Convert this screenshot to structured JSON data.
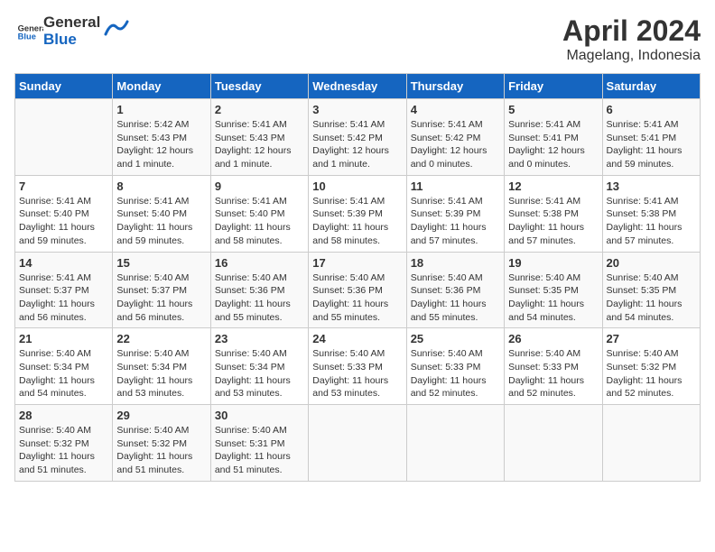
{
  "header": {
    "logo_general": "General",
    "logo_blue": "Blue",
    "title": "April 2024",
    "subtitle": "Magelang, Indonesia"
  },
  "days_of_week": [
    "Sunday",
    "Monday",
    "Tuesday",
    "Wednesday",
    "Thursday",
    "Friday",
    "Saturday"
  ],
  "weeks": [
    [
      {
        "day": "",
        "info": ""
      },
      {
        "day": "1",
        "info": "Sunrise: 5:42 AM\nSunset: 5:43 PM\nDaylight: 12 hours\nand 1 minute."
      },
      {
        "day": "2",
        "info": "Sunrise: 5:41 AM\nSunset: 5:43 PM\nDaylight: 12 hours\nand 1 minute."
      },
      {
        "day": "3",
        "info": "Sunrise: 5:41 AM\nSunset: 5:42 PM\nDaylight: 12 hours\nand 1 minute."
      },
      {
        "day": "4",
        "info": "Sunrise: 5:41 AM\nSunset: 5:42 PM\nDaylight: 12 hours\nand 0 minutes."
      },
      {
        "day": "5",
        "info": "Sunrise: 5:41 AM\nSunset: 5:41 PM\nDaylight: 12 hours\nand 0 minutes."
      },
      {
        "day": "6",
        "info": "Sunrise: 5:41 AM\nSunset: 5:41 PM\nDaylight: 11 hours\nand 59 minutes."
      }
    ],
    [
      {
        "day": "7",
        "info": "Sunrise: 5:41 AM\nSunset: 5:40 PM\nDaylight: 11 hours\nand 59 minutes."
      },
      {
        "day": "8",
        "info": "Sunrise: 5:41 AM\nSunset: 5:40 PM\nDaylight: 11 hours\nand 59 minutes."
      },
      {
        "day": "9",
        "info": "Sunrise: 5:41 AM\nSunset: 5:40 PM\nDaylight: 11 hours\nand 58 minutes."
      },
      {
        "day": "10",
        "info": "Sunrise: 5:41 AM\nSunset: 5:39 PM\nDaylight: 11 hours\nand 58 minutes."
      },
      {
        "day": "11",
        "info": "Sunrise: 5:41 AM\nSunset: 5:39 PM\nDaylight: 11 hours\nand 57 minutes."
      },
      {
        "day": "12",
        "info": "Sunrise: 5:41 AM\nSunset: 5:38 PM\nDaylight: 11 hours\nand 57 minutes."
      },
      {
        "day": "13",
        "info": "Sunrise: 5:41 AM\nSunset: 5:38 PM\nDaylight: 11 hours\nand 57 minutes."
      }
    ],
    [
      {
        "day": "14",
        "info": "Sunrise: 5:41 AM\nSunset: 5:37 PM\nDaylight: 11 hours\nand 56 minutes."
      },
      {
        "day": "15",
        "info": "Sunrise: 5:40 AM\nSunset: 5:37 PM\nDaylight: 11 hours\nand 56 minutes."
      },
      {
        "day": "16",
        "info": "Sunrise: 5:40 AM\nSunset: 5:36 PM\nDaylight: 11 hours\nand 55 minutes."
      },
      {
        "day": "17",
        "info": "Sunrise: 5:40 AM\nSunset: 5:36 PM\nDaylight: 11 hours\nand 55 minutes."
      },
      {
        "day": "18",
        "info": "Sunrise: 5:40 AM\nSunset: 5:36 PM\nDaylight: 11 hours\nand 55 minutes."
      },
      {
        "day": "19",
        "info": "Sunrise: 5:40 AM\nSunset: 5:35 PM\nDaylight: 11 hours\nand 54 minutes."
      },
      {
        "day": "20",
        "info": "Sunrise: 5:40 AM\nSunset: 5:35 PM\nDaylight: 11 hours\nand 54 minutes."
      }
    ],
    [
      {
        "day": "21",
        "info": "Sunrise: 5:40 AM\nSunset: 5:34 PM\nDaylight: 11 hours\nand 54 minutes."
      },
      {
        "day": "22",
        "info": "Sunrise: 5:40 AM\nSunset: 5:34 PM\nDaylight: 11 hours\nand 53 minutes."
      },
      {
        "day": "23",
        "info": "Sunrise: 5:40 AM\nSunset: 5:34 PM\nDaylight: 11 hours\nand 53 minutes."
      },
      {
        "day": "24",
        "info": "Sunrise: 5:40 AM\nSunset: 5:33 PM\nDaylight: 11 hours\nand 53 minutes."
      },
      {
        "day": "25",
        "info": "Sunrise: 5:40 AM\nSunset: 5:33 PM\nDaylight: 11 hours\nand 52 minutes."
      },
      {
        "day": "26",
        "info": "Sunrise: 5:40 AM\nSunset: 5:33 PM\nDaylight: 11 hours\nand 52 minutes."
      },
      {
        "day": "27",
        "info": "Sunrise: 5:40 AM\nSunset: 5:32 PM\nDaylight: 11 hours\nand 52 minutes."
      }
    ],
    [
      {
        "day": "28",
        "info": "Sunrise: 5:40 AM\nSunset: 5:32 PM\nDaylight: 11 hours\nand 51 minutes."
      },
      {
        "day": "29",
        "info": "Sunrise: 5:40 AM\nSunset: 5:32 PM\nDaylight: 11 hours\nand 51 minutes."
      },
      {
        "day": "30",
        "info": "Sunrise: 5:40 AM\nSunset: 5:31 PM\nDaylight: 11 hours\nand 51 minutes."
      },
      {
        "day": "",
        "info": ""
      },
      {
        "day": "",
        "info": ""
      },
      {
        "day": "",
        "info": ""
      },
      {
        "day": "",
        "info": ""
      }
    ]
  ]
}
